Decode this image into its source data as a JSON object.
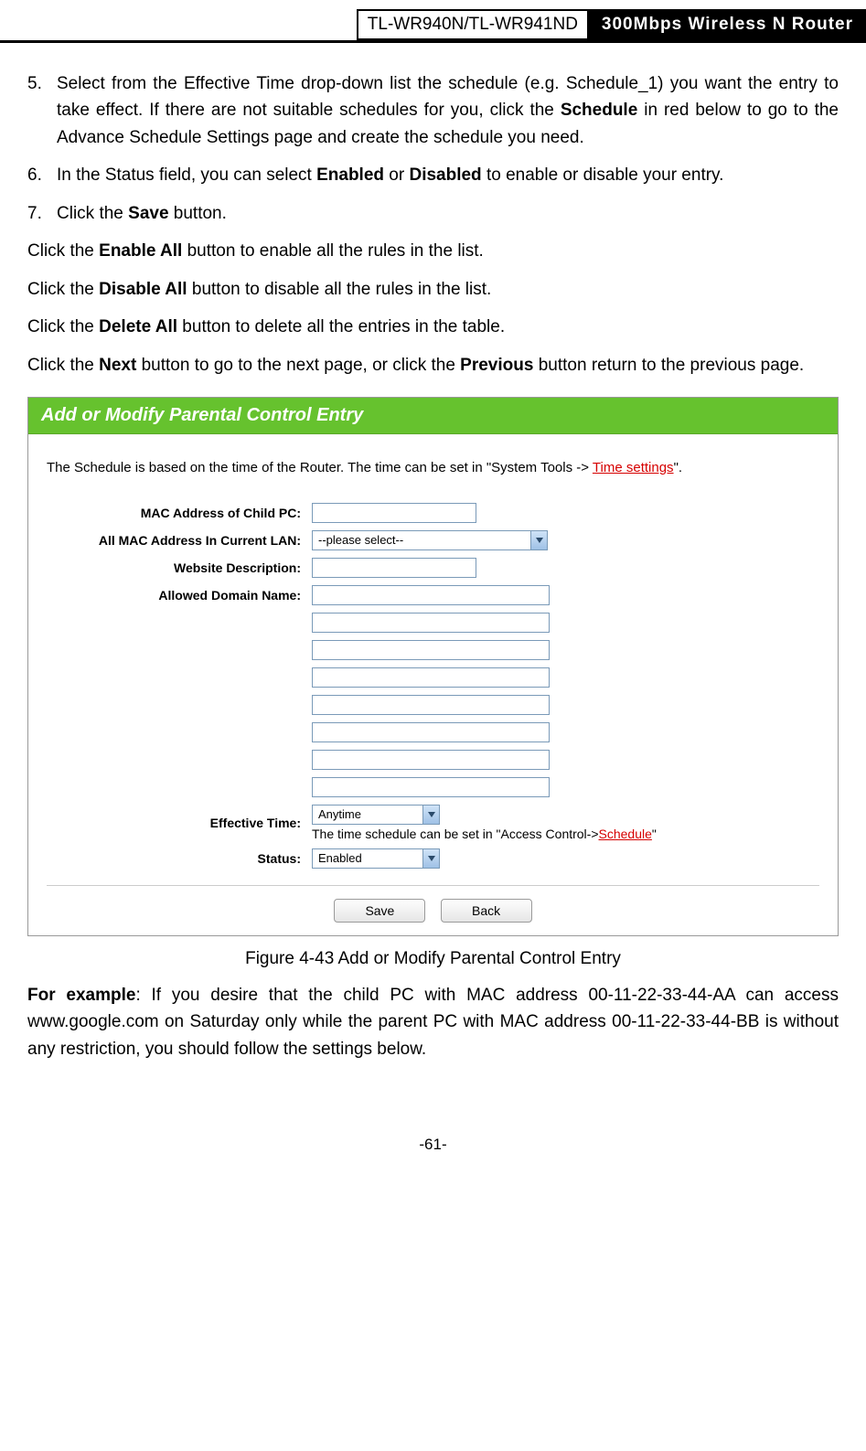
{
  "header": {
    "model": "TL-WR940N/TL-WR941ND",
    "title": "300Mbps Wireless N Router"
  },
  "steps": {
    "s5": {
      "num": "5.",
      "t1": "Select from the Effective Time drop-down list the schedule (e.g. Schedule_1) you want the entry to take effect. If there are not suitable schedules for you, click the ",
      "b1": "Schedule",
      "t2": " in red below to go to the Advance Schedule Settings page and create the schedule you need."
    },
    "s6": {
      "num": "6.",
      "t1": "In the Status field, you can select ",
      "b1": "Enabled",
      "t2": " or ",
      "b2": "Disabled",
      "t3": " to enable or disable your entry."
    },
    "s7": {
      "num": "7.",
      "t1": "Click the ",
      "b1": "Save",
      "t2": " button."
    }
  },
  "paras": {
    "p1": {
      "t1": "Click the ",
      "b1": "Enable All",
      "t2": " button to enable all the rules in the list."
    },
    "p2": {
      "t1": "Click the ",
      "b1": "Disable All",
      "t2": " button to disable all the rules in the list."
    },
    "p3": {
      "t1": "Click the ",
      "b1": "Delete All",
      "t2": " button to delete all the entries in the table."
    },
    "p4": {
      "t1": "Click the ",
      "b1": "Next",
      "t2": " button to go to the next page, or click the ",
      "b2": "Previous",
      "t3": " button return to the previous page."
    }
  },
  "figure": {
    "title": "Add or Modify Parental Control Entry",
    "note_pre": "The Schedule is based on the time of the Router. The time can be set in \"System Tools -> ",
    "note_link": "Time settings",
    "note_post": "\".",
    "labels": {
      "mac_child": "MAC Address of Child PC:",
      "all_mac": "All MAC Address In Current LAN:",
      "web_desc": "Website Description:",
      "allowed": "Allowed Domain Name:",
      "eff_time": "Effective Time:",
      "status": "Status:"
    },
    "select_mac": "--please select--",
    "select_time": "Anytime",
    "select_status": "Enabled",
    "hint_pre": "The time schedule can be set in \"Access Control->",
    "hint_link": "Schedule",
    "hint_post": "\"",
    "btn_save": "Save",
    "btn_back": "Back",
    "caption": "Figure 4-43    Add or Modify Parental Control Entry"
  },
  "example": {
    "b1": "For example",
    "t1": ": If you desire that the child PC with MAC address 00-11-22-33-44-AA can access www.google.com on Saturday only while the parent PC with MAC address 00-11-22-33-44-BB is without any restriction, you should follow the settings below."
  },
  "footer": "-61-"
}
